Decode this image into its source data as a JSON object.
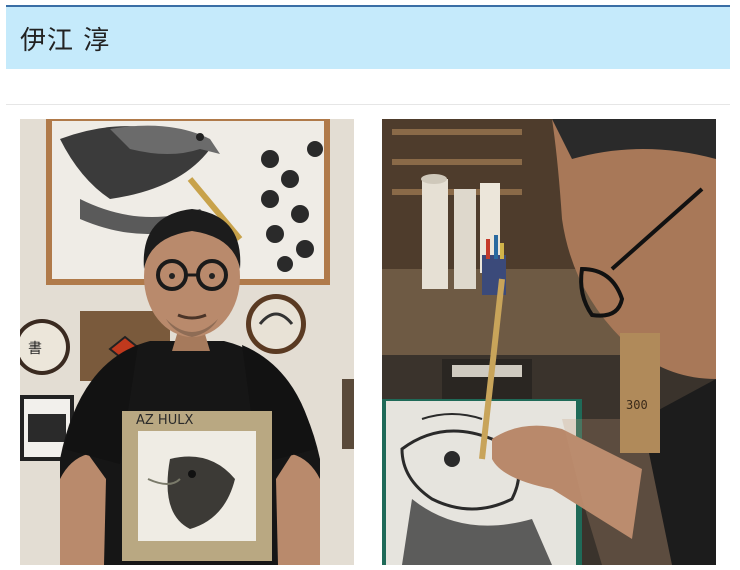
{
  "profile": {
    "name": "伊江 淳"
  },
  "gallery": {
    "photos": [
      {
        "alt": "portrait-with-artwork"
      },
      {
        "alt": "painting-at-desk"
      }
    ]
  },
  "colors": {
    "title_background": "#c5eafb",
    "title_border": "#3a6ea5"
  }
}
